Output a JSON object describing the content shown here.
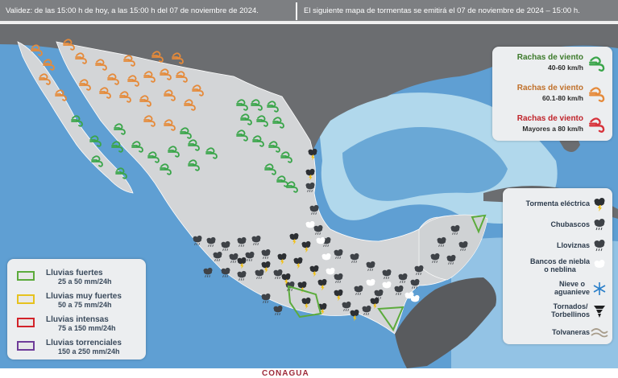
{
  "header": {
    "validity": "Validez: de las 15:00  h de hoy, a las 15:00  h del 07 de noviembre de 2024.",
    "next_map": "El siguiente mapa de tormentas se emitirá el 07 de noviembre de 2024 – 15:00  h."
  },
  "colors": {
    "ocean": "#5f9fd3",
    "land": "#d6d7d8",
    "mexico": "#cfd2d4",
    "usa": "#6b6d70",
    "wind_green": "#3aa54a",
    "wind_orange": "#e58a3a",
    "wind_red": "#d7323a"
  },
  "wind_legend": [
    {
      "title": "Rachas de viento",
      "range": "40-60 km/h",
      "color": "#3aa54a",
      "icon": "wind-icon-green"
    },
    {
      "title": "Rachas de viento",
      "range": "60.1-80 km/h",
      "color": "#e58a3a",
      "icon": "wind-icon-orange"
    },
    {
      "title": "Rachas de viento",
      "range": "Mayores a 80 km/h",
      "color": "#d7323a",
      "icon": "wind-icon-red"
    }
  ],
  "phenomena_legend": [
    {
      "label": "Tormenta eléctrica",
      "icon": "thunderstorm-icon"
    },
    {
      "label": "Chubascos",
      "icon": "showers-icon"
    },
    {
      "label": "Lloviznas",
      "icon": "drizzle-icon"
    },
    {
      "label": "Bancos de niebla\no neblina",
      "icon": "fog-icon"
    },
    {
      "label": "Nieve o\naguanieve",
      "icon": "snow-icon"
    },
    {
      "label": "Tornados/\nTorbellinos",
      "icon": "tornado-icon"
    },
    {
      "label": "Tolvaneras",
      "icon": "dust-icon"
    }
  ],
  "rain_legend": [
    {
      "name": "Lluvias fuertes",
      "range": "25 a 50 mm/24h",
      "color": "#5cab3c"
    },
    {
      "name": "Lluvias muy fuertes",
      "range": "50 a 75 mm/24h",
      "color": "#e6c21f"
    },
    {
      "name": "Lluvias intensas",
      "range": "75 a 150 mm/24h",
      "color": "#d2232a"
    },
    {
      "name": "Lluvias torrenciales",
      "range": "150 a 250 mm/24h",
      "color": "#6f3c99"
    }
  ],
  "footer": {
    "logo": "CONAGUA"
  }
}
